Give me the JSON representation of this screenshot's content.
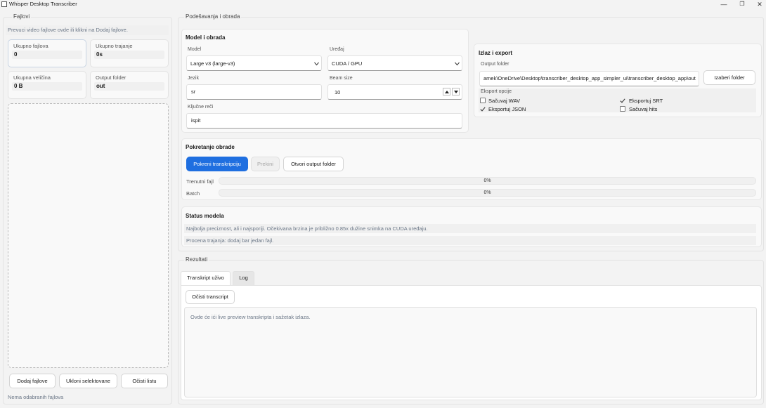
{
  "window": {
    "title": "Whisper Desktop Transcriber",
    "minimize_glyph": "—",
    "maximize_glyph": "❐",
    "close_glyph": "✕"
  },
  "files": {
    "group_title": "Fajlovi",
    "drop_hint": "Prevuci video fajlove ovde ili klikni na Dodaj fajlove.",
    "stats": [
      {
        "label": "Ukupno fajlova",
        "value": "0"
      },
      {
        "label": "Ukupno trajanje",
        "value": "0s"
      },
      {
        "label": "Ukupna veličina",
        "value": "0 B"
      },
      {
        "label": "Output folder",
        "value": "out"
      }
    ],
    "add_button": "Dodaj fajlove",
    "remove_button": "Ukloni selektovane",
    "clear_button": "Očisti listu",
    "selection_status": "Nema odabranih fajlova"
  },
  "settings": {
    "group_title": "Podešavanja i obrada",
    "model_section": {
      "title": "Model i obrada",
      "model_label": "Model",
      "model_value": "Large v3 (large-v3)",
      "device_label": "Uređaj",
      "device_value": "CUDA / GPU",
      "language_label": "Jezik",
      "language_value": "sr",
      "beam_label": "Beam size",
      "beam_value": "10",
      "keywords_label": "Ključne reči",
      "keywords_value": "ispit"
    },
    "output_section": {
      "title": "Izlaz i export",
      "folder_label": "Output folder",
      "folder_value": "amek\\OneDrive\\Desktop\\transcriber_desktop_app_simpler_ui\\transcriber_desktop_app\\out",
      "choose_button": "Izaberi folder",
      "export_label": "Eksport opcije",
      "options": [
        {
          "label": "Sačuvaj WAV",
          "checked": false
        },
        {
          "label": "Eksportuj SRT",
          "checked": true
        },
        {
          "label": "Eksportuj JSON",
          "checked": true
        },
        {
          "label": "Sačuvaj hits",
          "checked": false
        }
      ]
    },
    "run_section": {
      "title": "Pokretanje obrade",
      "start_button": "Pokreni transkripciju",
      "stop_button": "Prekini",
      "open_output_button": "Otvori output folder",
      "current_label": "Trenutni fajl",
      "current_progress": "0%",
      "batch_label": "Batch",
      "batch_progress": "0%"
    },
    "status_section": {
      "title": "Status modela",
      "description": "Najbolja preciznost, ali i najsporiji. Očekivana brzina je približno 0.85x dužine snimka na CUDA uređaju.",
      "estimate": "Procena trajanja: dodaj bar jedan fajl."
    }
  },
  "results": {
    "group_title": "Rezultati",
    "tabs": [
      "Transkript uživo",
      "Log"
    ],
    "active_tab": "Transkript uživo",
    "clear_button": "Očisti transcript",
    "placeholder": "Ovde će ići live preview transkripta i sažetak izlaza."
  },
  "icons": {
    "dropdown": "chevron-down-icon",
    "spin_up": "triangle-up-icon",
    "spin_down": "triangle-down-icon",
    "checkmark": "checkmark-icon"
  },
  "colors": {
    "accent": "#1f6fe0",
    "window_bg": "#f3f3f3",
    "card_bg": "#f9f9f9"
  }
}
